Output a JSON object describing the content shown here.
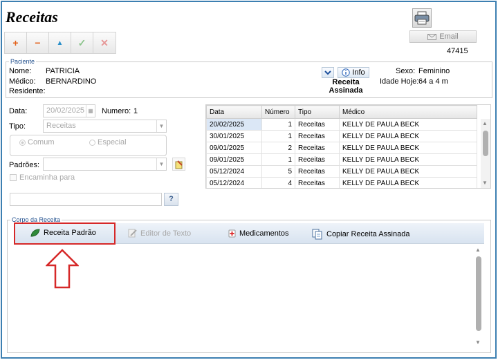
{
  "header": {
    "title": "Receitas",
    "email_label": "Email",
    "record_number": "47415"
  },
  "toolbar": {
    "add": "+",
    "remove": "−",
    "up": "▲",
    "confirm": "✓",
    "cancel": "✕"
  },
  "patient": {
    "legend": "Paciente",
    "nome_label": "Nome:",
    "nome_value": "PATRICIA",
    "medico_label": "Médico:",
    "medico_value": "BERNARDINO",
    "residente_label": "Residente:",
    "info_label": "Info",
    "receita_assinada": "Receita\nAssinada",
    "sexo_label": "Sexo:",
    "sexo_value": "Feminino",
    "idade_label": "Idade Hoje:",
    "idade_value": "64 a 4 m"
  },
  "form": {
    "data_label": "Data:",
    "data_value": "20/02/2025",
    "numero_label": "Numero:",
    "numero_value": "1",
    "tipo_label": "Tipo:",
    "tipo_value": "Receitas",
    "radio_comum": "Comum",
    "radio_especial": "Especial",
    "padroes_label": "Padrões:",
    "encaminha_label": "Encaminha para",
    "help_label": "?"
  },
  "grid": {
    "columns": [
      "Data",
      "Número",
      "Tipo",
      "Médico"
    ],
    "rows": [
      {
        "data": "20/02/2025",
        "numero": "1",
        "tipo": "Receitas",
        "medico": "KELLY DE PAULA BECK"
      },
      {
        "data": "30/01/2025",
        "numero": "1",
        "tipo": "Receitas",
        "medico": "KELLY DE PAULA BECK"
      },
      {
        "data": "09/01/2025",
        "numero": "2",
        "tipo": "Receitas",
        "medico": "KELLY DE PAULA BECK"
      },
      {
        "data": "09/01/2025",
        "numero": "1",
        "tipo": "Receitas",
        "medico": "KELLY DE PAULA BECK"
      },
      {
        "data": "05/12/2024",
        "numero": "5",
        "tipo": "Receitas",
        "medico": "KELLY DE PAULA BECK"
      },
      {
        "data": "05/12/2024",
        "numero": "4",
        "tipo": "Receitas",
        "medico": "KELLY DE PAULA BECK"
      }
    ]
  },
  "corpo": {
    "legend": "Corpo da Receita",
    "tab_receita_padrao": "Receita Padrão",
    "tab_editor": "Editor de Texto",
    "tab_medicamentos": "Medicamentos",
    "tab_copiar": "Copiar Receita Assinada"
  },
  "colors": {
    "frame_border": "#3c7fb1",
    "highlight": "#d62828"
  },
  "icons": [
    "printer-icon",
    "envelope-icon",
    "chevron-down-icon",
    "info-icon",
    "calendar-icon",
    "leaf-icon",
    "pencil-icon",
    "medkit-icon",
    "copy-icon",
    "arrow-up-icon"
  ]
}
